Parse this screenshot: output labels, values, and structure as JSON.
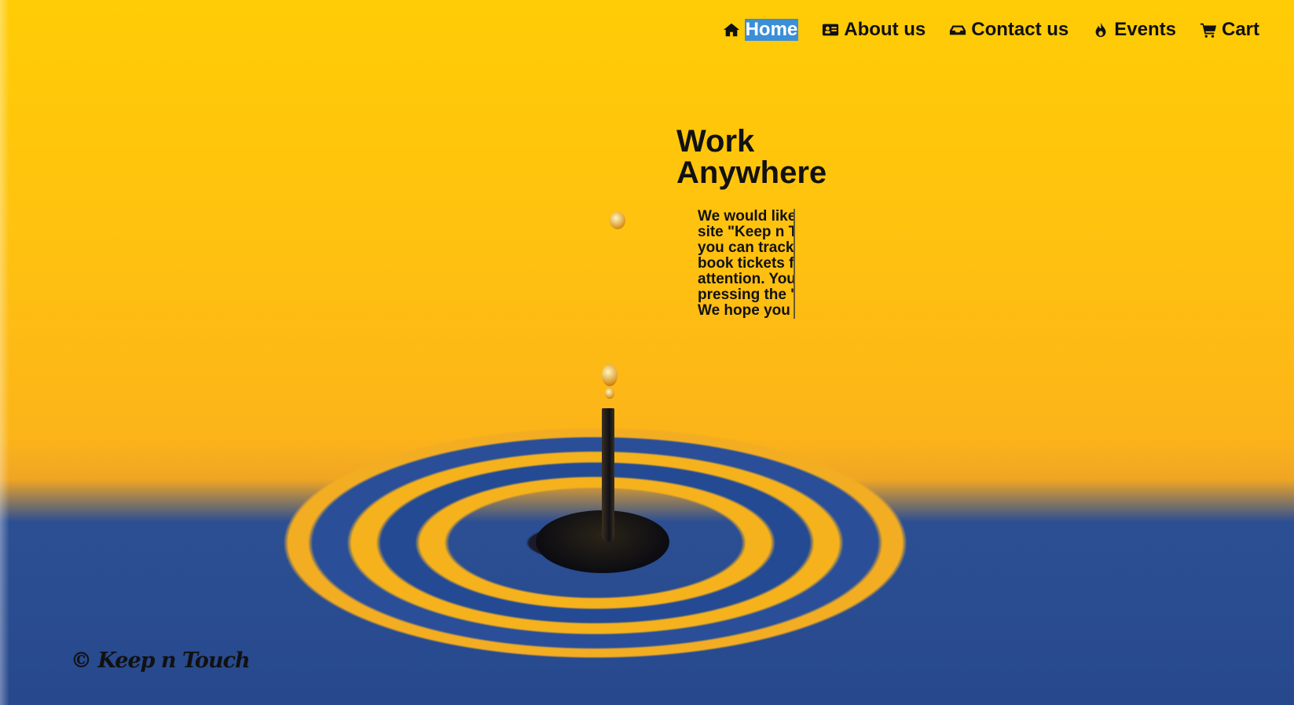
{
  "nav": {
    "home": {
      "label": "Home",
      "icon": "home-icon"
    },
    "about": {
      "label": "About us",
      "icon": "id-card-icon"
    },
    "contact": {
      "label": "Contact us",
      "icon": "inbox-icon"
    },
    "events": {
      "label": "Events",
      "icon": "fire-icon"
    },
    "cart": {
      "label": "Cart",
      "icon": "cart-icon"
    },
    "active": "home"
  },
  "hero": {
    "title": "Work Anywhere",
    "lines": [
      "We would like",
      "site \"Keep n T",
      "you can track",
      "book tickets f",
      "attention. You",
      "pressing the '",
      "We hope you"
    ]
  },
  "footer": {
    "text": "© Keep n Touch"
  },
  "colors": {
    "accent": "#3b8fd8",
    "background_top": "#ffcc05",
    "background_water": "#27488c"
  }
}
